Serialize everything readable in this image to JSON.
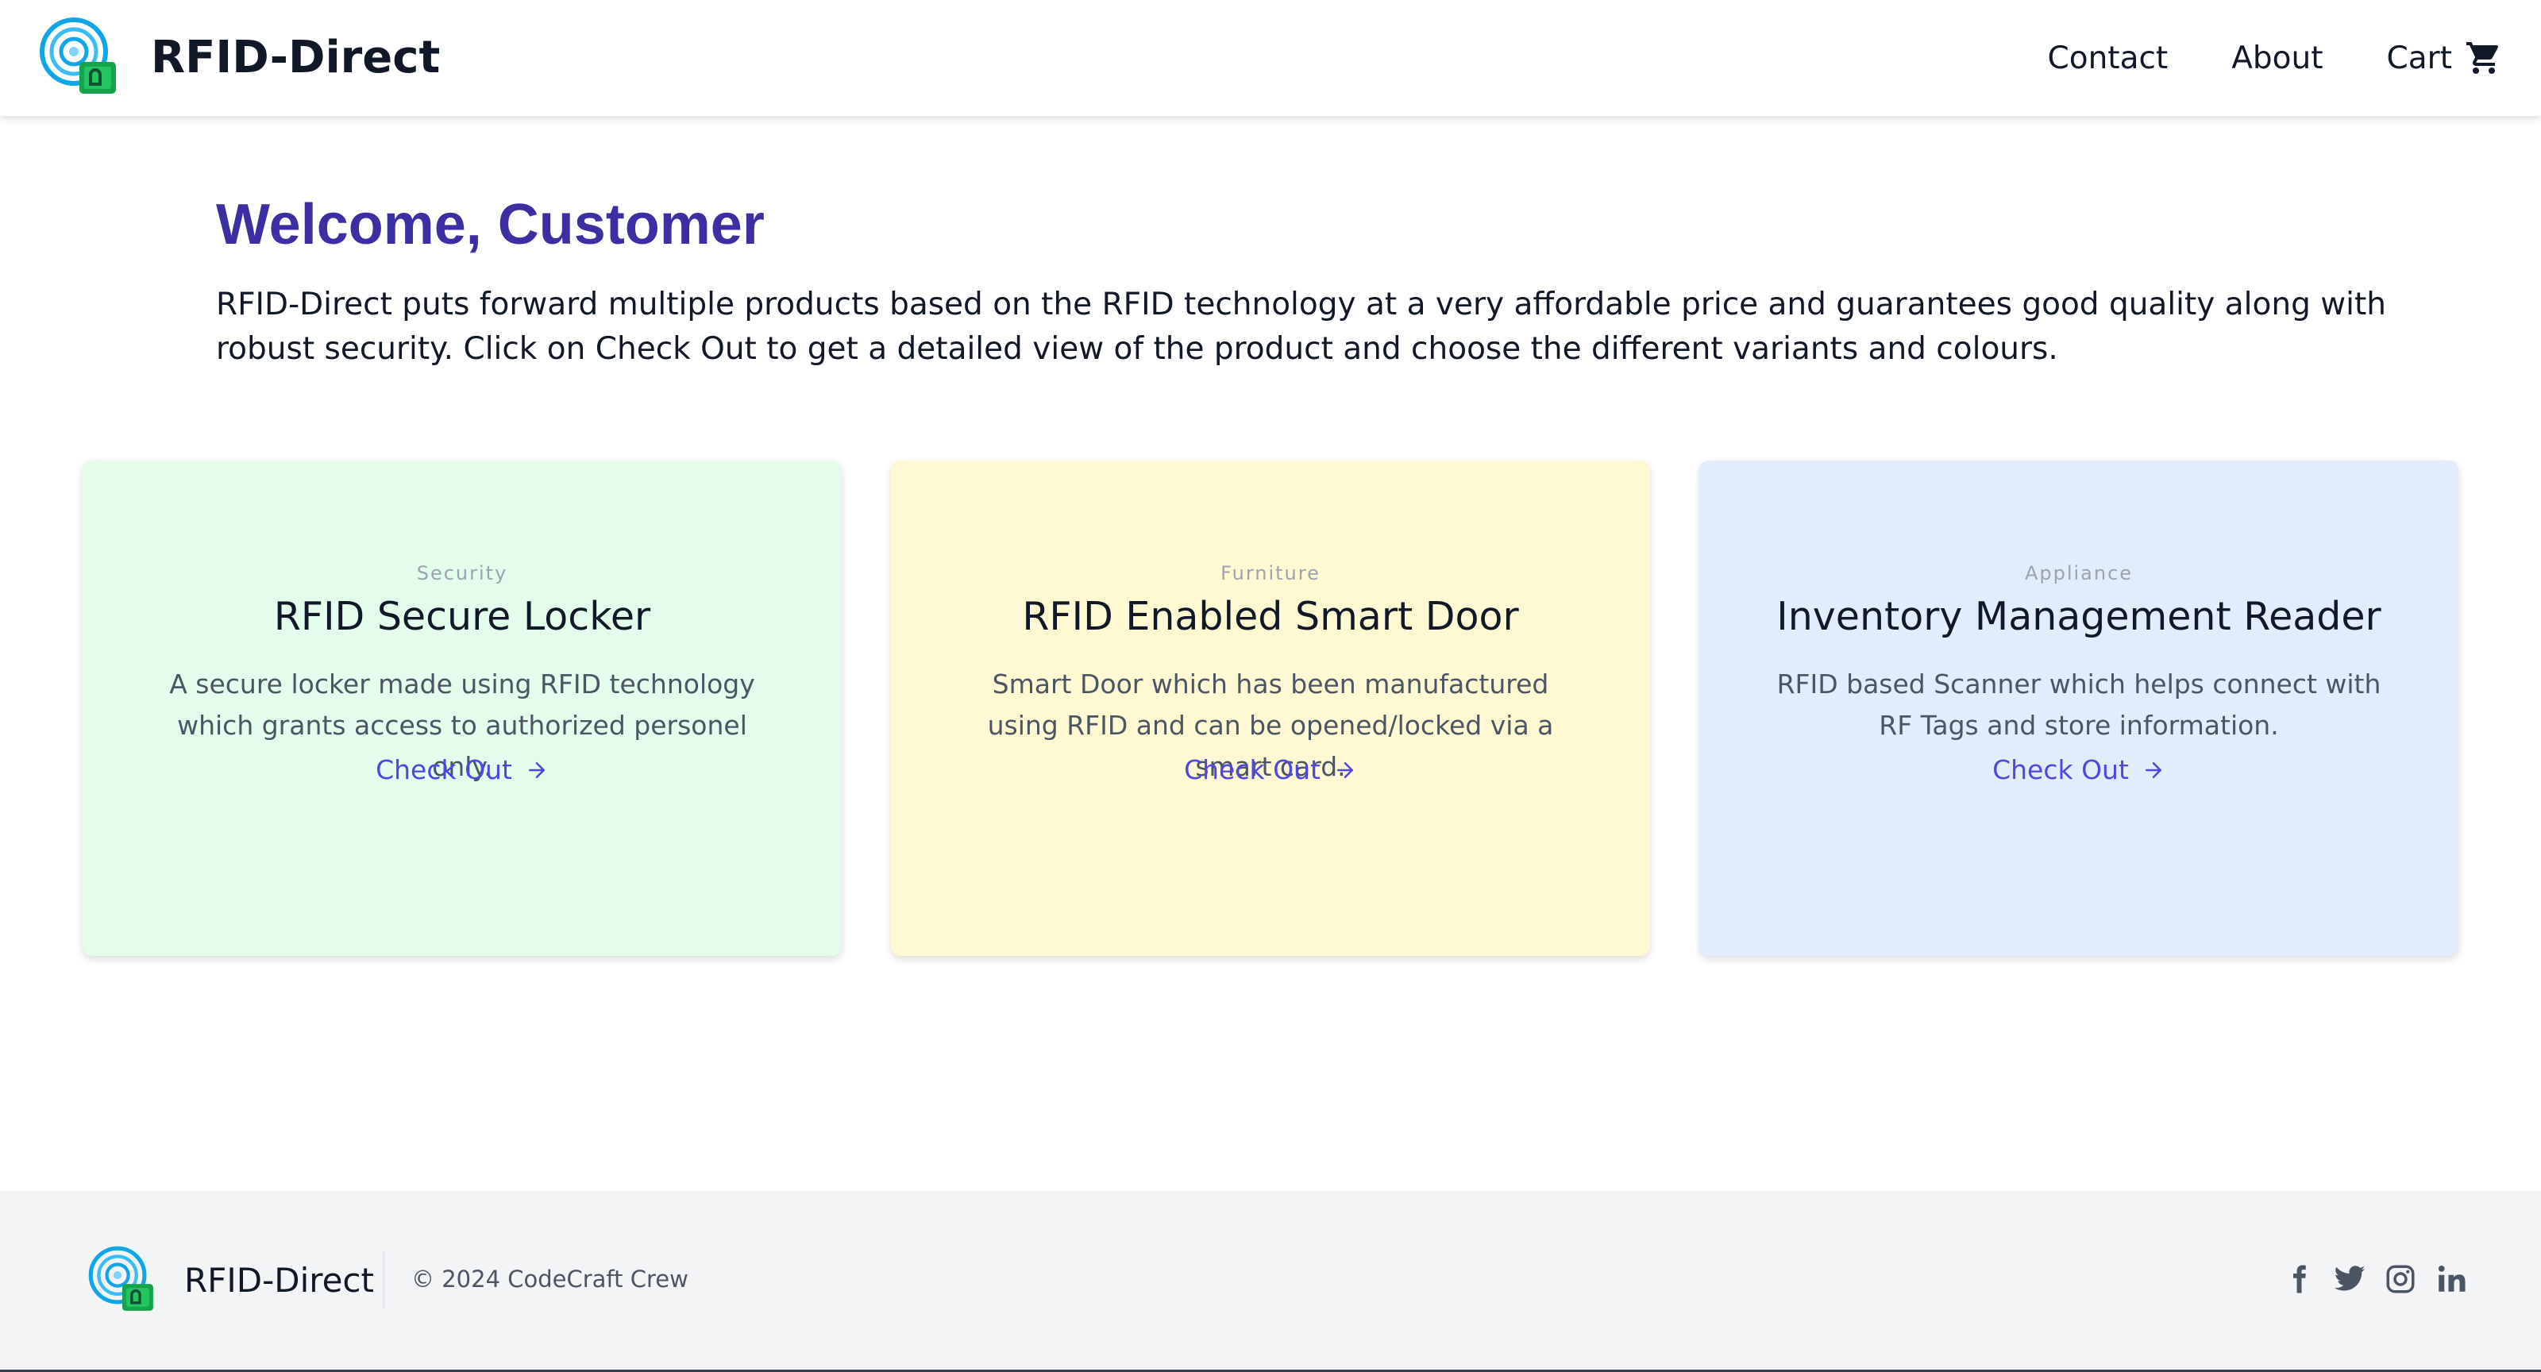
{
  "header": {
    "brand_name": "RFID-Direct",
    "nav": {
      "contact": "Contact",
      "about": "About",
      "cart": "Cart"
    }
  },
  "main": {
    "welcome_title": "Welcome, Customer",
    "intro": "RFID-Direct puts forward multiple products based on the RFID technology at a very affordable price and guarantees good quality along with robust security. Click on Check Out to get a detailed view of the product and choose the different variants and colours.",
    "cards": [
      {
        "category": "Security",
        "title": "RFID Secure Locker",
        "description": "A secure locker made using RFID technology which grants access to authorized personel only.",
        "link": "Check Out",
        "background": "#e3fcec"
      },
      {
        "category": "Furniture",
        "title": "RFID Enabled Smart Door",
        "description": "Smart Door which has been manufactured using RFID and can be opened/locked via a smart card.",
        "link": "Check Out",
        "background": "#fef9d2"
      },
      {
        "category": "Appliance",
        "title": "Inventory Management Reader",
        "description": "RFID based Scanner which helps connect with RF Tags and store information.",
        "link": "Check Out",
        "background": "#e2edfc"
      }
    ]
  },
  "footer": {
    "brand_name": "RFID-Direct",
    "copyright": "© 2024 CodeCraft Crew",
    "social": [
      "facebook-icon",
      "twitter-icon",
      "instagram-icon",
      "linkedin-icon"
    ]
  },
  "colors": {
    "accent": "#4f46e5",
    "heading": "#3b2fa3",
    "footer_bg": "#f3f4f6"
  }
}
